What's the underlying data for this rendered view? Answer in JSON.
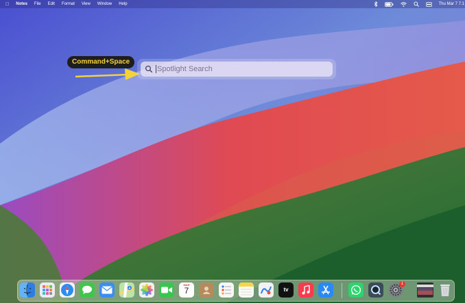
{
  "menubar": {
    "apple_icon": "apple-icon",
    "app_name": "Notes",
    "menus": [
      "File",
      "Edit",
      "Format",
      "View",
      "Window",
      "Help"
    ],
    "status_icons": [
      "bluetooth-icon",
      "battery-icon",
      "wifi-icon",
      "search-icon",
      "control-center-icon"
    ],
    "datetime": "Thu Mar 7  7:1"
  },
  "annotation": {
    "shortcut_label": "Command+Space",
    "label_bg": "#1e1e1e",
    "label_text_color": "#f3d23a",
    "arrow_color": "#f3d23a"
  },
  "spotlight": {
    "placeholder": "Spotlight Search",
    "icon": "magnifying-glass-icon"
  },
  "calendar_date": "7",
  "calendar_month": "MAR",
  "apple_tv_label": "tv",
  "dock": {
    "apps": [
      {
        "name": "Finder",
        "icon": "finder-icon",
        "color": "#2f7de1"
      },
      {
        "name": "Launchpad",
        "icon": "launchpad-icon",
        "color": "#e9ecf1"
      },
      {
        "name": "Safari",
        "icon": "safari-icon",
        "color": "#2e8cf0"
      },
      {
        "name": "Messages",
        "icon": "messages-icon",
        "color": "#3fc64b"
      },
      {
        "name": "Mail",
        "icon": "mail-icon",
        "color": "#3a8df1"
      },
      {
        "name": "Maps",
        "icon": "maps-icon",
        "color": "#63b36a"
      },
      {
        "name": "Photos",
        "icon": "photos-icon",
        "color": "#f4f1ee"
      },
      {
        "name": "FaceTime",
        "icon": "facetime-icon",
        "color": "#39c552"
      },
      {
        "name": "Calendar",
        "icon": "calendar-icon",
        "color": "#ffffff"
      },
      {
        "name": "Contacts",
        "icon": "contacts-icon",
        "color": "#b58a5c"
      },
      {
        "name": "Reminders",
        "icon": "reminders-icon",
        "color": "#f7f7f7"
      },
      {
        "name": "Notes",
        "icon": "notes-icon",
        "color": "#f5d54a"
      },
      {
        "name": "Freeform",
        "icon": "freeform-icon",
        "color": "#f2f2f2"
      },
      {
        "name": "Apple TV",
        "icon": "apple-tv-icon",
        "color": "#111111"
      },
      {
        "name": "Music",
        "icon": "music-icon",
        "color": "#fa3b4e"
      },
      {
        "name": "App Store",
        "icon": "app-store-icon",
        "color": "#2a8af5"
      },
      {
        "name": "WhatsApp",
        "icon": "whatsapp-icon",
        "color": "#2cd46b"
      },
      {
        "name": "QuickTime Player",
        "icon": "quicktime-icon",
        "color": "#3d4a57"
      },
      {
        "name": "System Settings",
        "icon": "system-settings-icon",
        "color": "#7f8287"
      },
      {
        "name": "Recent Window",
        "icon": "window-thumbnail-icon",
        "color": "#303030"
      },
      {
        "name": "Trash",
        "icon": "trash-icon",
        "color": "#dcdde0"
      }
    ],
    "settings_badge": "1"
  },
  "wallpaper": {
    "top_color": "#4a56c8",
    "middle_band_color": "#df4a4a",
    "bottom_color": "#2e7a3a"
  }
}
